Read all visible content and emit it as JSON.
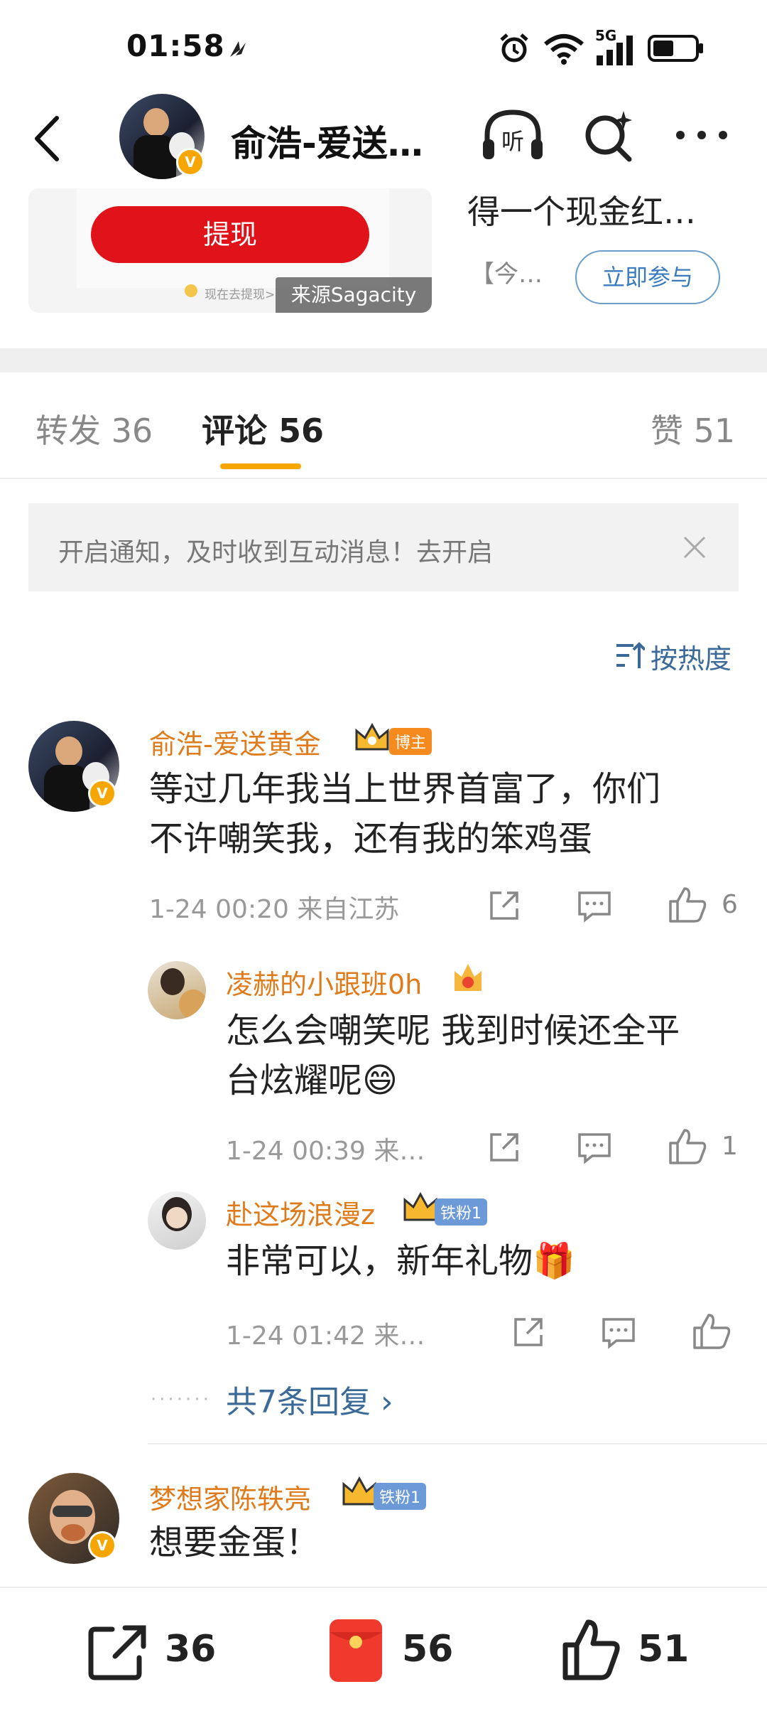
{
  "status_bar": {
    "time": "01:58",
    "network": "5G"
  },
  "nav": {
    "title": "俞浩-爱送…",
    "listen_label": "听"
  },
  "card": {
    "withdraw_label": "提现",
    "small_note": "现在去提现>",
    "source_tag": "来源Sagacity",
    "right_title": "得一个现金红…",
    "right_sub": "【今…",
    "join_label": "立即参与"
  },
  "tabs": {
    "repost": "转发 36",
    "comments": "评论 56",
    "likes": "赞 51"
  },
  "notify": {
    "text": "开启通知，及时收到互动消息！去开启"
  },
  "sort": {
    "label": "按热度"
  },
  "comments": [
    {
      "name": "俞浩-爱送黄金",
      "badge": "博主",
      "text_line1": "等过几年我当上世界首富了，你们",
      "text_line2": "不许嘲笑我，还有我的笨鸡蛋",
      "meta": "1-24 00:20  来自江苏",
      "likes": "6",
      "replies": [
        {
          "name": "凌赫的小跟班0h",
          "text_line1": "怎么会嘲笑呢 我到时候还全平",
          "text_line2": "台炫耀呢😄",
          "meta": "1-24 00:39  来…",
          "likes": "1"
        },
        {
          "name": "赴这场浪漫z",
          "badge": "铁粉1",
          "text_line1": "非常可以，新年礼物🎁",
          "meta": "1-24 01:42  来…",
          "likes": ""
        }
      ],
      "more_replies": "共7条回复 ›"
    },
    {
      "name": "梦想家陈轶亮",
      "badge": "铁粉1",
      "text_line1": "想要金蛋！"
    }
  ],
  "bottom_bar": {
    "repost_count": "36",
    "comment_count": "56",
    "like_count": "51"
  },
  "colors": {
    "accent": "#f7a600",
    "link": "#3b6a99",
    "username": "#e07b1c",
    "withdraw": "#e0121a"
  }
}
